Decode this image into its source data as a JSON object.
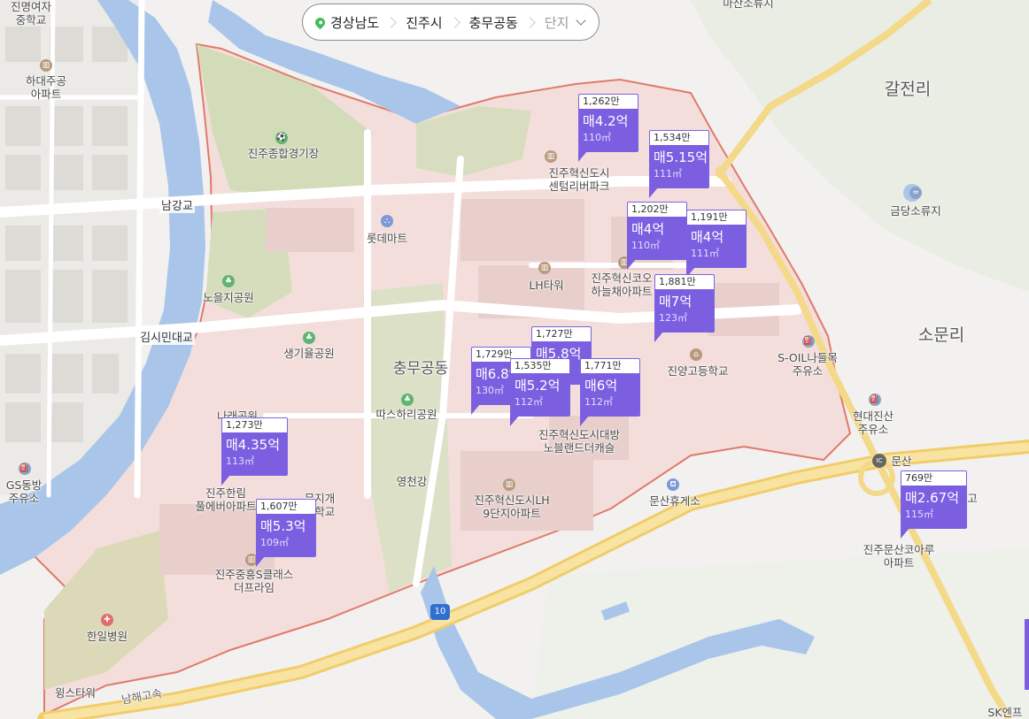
{
  "breadcrumb": {
    "province": "경상남도",
    "city": "진주시",
    "district": "충무공동",
    "filter": "단지"
  },
  "map_labels": {
    "jinmyeong_school": "진명여자\n중학교",
    "hadae_apt": "하대주공\n아파트",
    "stadium": "진주종합경기장",
    "namgang_bridge": "남강교",
    "lotte_mart": "롯데마트",
    "noeul_park": "노을지공원",
    "lh_tower": "LH타워",
    "gimsimin_bridge": "김시민대교",
    "saenggiyul_park": "생기율공원",
    "chungmugong_dong": "충무공동",
    "ttaseuhari_park": "따스하리공원",
    "riverpark": "진주혁신도시\n센텀리버파크",
    "hanulchae": "진주혁신코오\n하늘채아파트",
    "jinyang_high": "진양고등학교",
    "daebang": "진주혁신도시대방\n노블랜드더캐슬",
    "yeongcheon_river": "영천강",
    "lh9_apt": "진주혁신도시LH\n9단지아파트",
    "hallim_apt": "진주한림\n풀에버아파트",
    "jungheung_apt": "진주중흥S클래스\n더프라임",
    "hanil_hospital": "한일병원",
    "wings_tower": "윙스타워",
    "namhae_expressway": "남해고속",
    "munsan_rest": "문산휴게소",
    "munsan_ic": "문산",
    "kolon_apt": "진주문산코아루\n아파트",
    "galjeon_ri": "갈전리",
    "geumdang": "금당소류지",
    "somun_ri": "소문리",
    "soil_station": "S-OIL나들목\n주유소",
    "hyundai_station": "현대진산\n주유소",
    "gs_station": "GS동방\n주유소",
    "masan_reservoir": "마산소류지",
    "sk_station": "SK엔프",
    "route_10": "10",
    "ic_badge": "IC",
    "ne_school_part": "고",
    "mid_school_part": "무지개\n중학교",
    "park_part": "나래공원"
  },
  "markers": [
    {
      "per_pyeong": "1,262만",
      "price": "매4.2억",
      "area": "110㎡"
    },
    {
      "per_pyeong": "1,534만",
      "price": "매5.15억",
      "area": "111㎡"
    },
    {
      "per_pyeong": "1,202만",
      "price": "매4억",
      "area": "110㎡"
    },
    {
      "per_pyeong": "1,191만",
      "price": "매4억",
      "area": "111㎡"
    },
    {
      "per_pyeong": "1,881만",
      "price": "매7억",
      "area": "123㎡"
    },
    {
      "per_pyeong": "1,727만",
      "price": "매5.8억",
      "area": ""
    },
    {
      "per_pyeong": "1,729만",
      "price": "매6.8억",
      "area": "130㎡"
    },
    {
      "per_pyeong": "1,535만",
      "price": "매5.2억",
      "area": "112㎡"
    },
    {
      "per_pyeong": "1,771만",
      "price": "매6억",
      "area": "112㎡"
    },
    {
      "per_pyeong": "1,273만",
      "price": "매4.35억",
      "area": "113㎡"
    },
    {
      "per_pyeong": "1,607만",
      "price": "매5.3억",
      "area": "109㎡"
    },
    {
      "per_pyeong": "769만",
      "price": "매2.67억",
      "area": "115㎡"
    }
  ],
  "colors": {
    "district_fill": "#f3dcd9",
    "district_border": "#e07a6a",
    "river": "#a9c6ea",
    "green": "#cbd7b0",
    "marker": "#7b5fe0",
    "road_major": "#f4d98a"
  }
}
